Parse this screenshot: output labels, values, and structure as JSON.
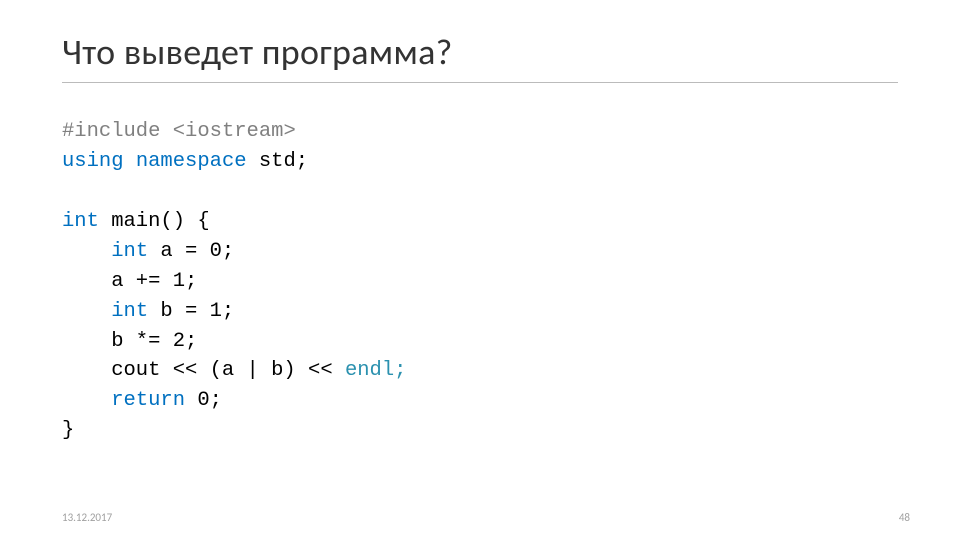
{
  "slide": {
    "title": "Что выведет программа?"
  },
  "code": {
    "l1a": "#include",
    "l1b": " ",
    "l1c": "<iostream>",
    "l2a": "using",
    "l2b": " ",
    "l2c": "namespace",
    "l2d": " std;",
    "l3a": "int",
    "l3b": " main() {",
    "l4a": "    ",
    "l4b": "int",
    "l4c": " a = 0;",
    "l5": "    a += 1;",
    "l6a": "    ",
    "l6b": "int",
    "l6c": " b = 1;",
    "l7": "    b *= 2;",
    "l8a": "    cout << (a | b) << ",
    "l8b": "endl;",
    "l9a": "    ",
    "l9b": "return",
    "l9c": " 0;",
    "l10": "}"
  },
  "footer": {
    "date": "13.12.2017",
    "page": "48"
  }
}
